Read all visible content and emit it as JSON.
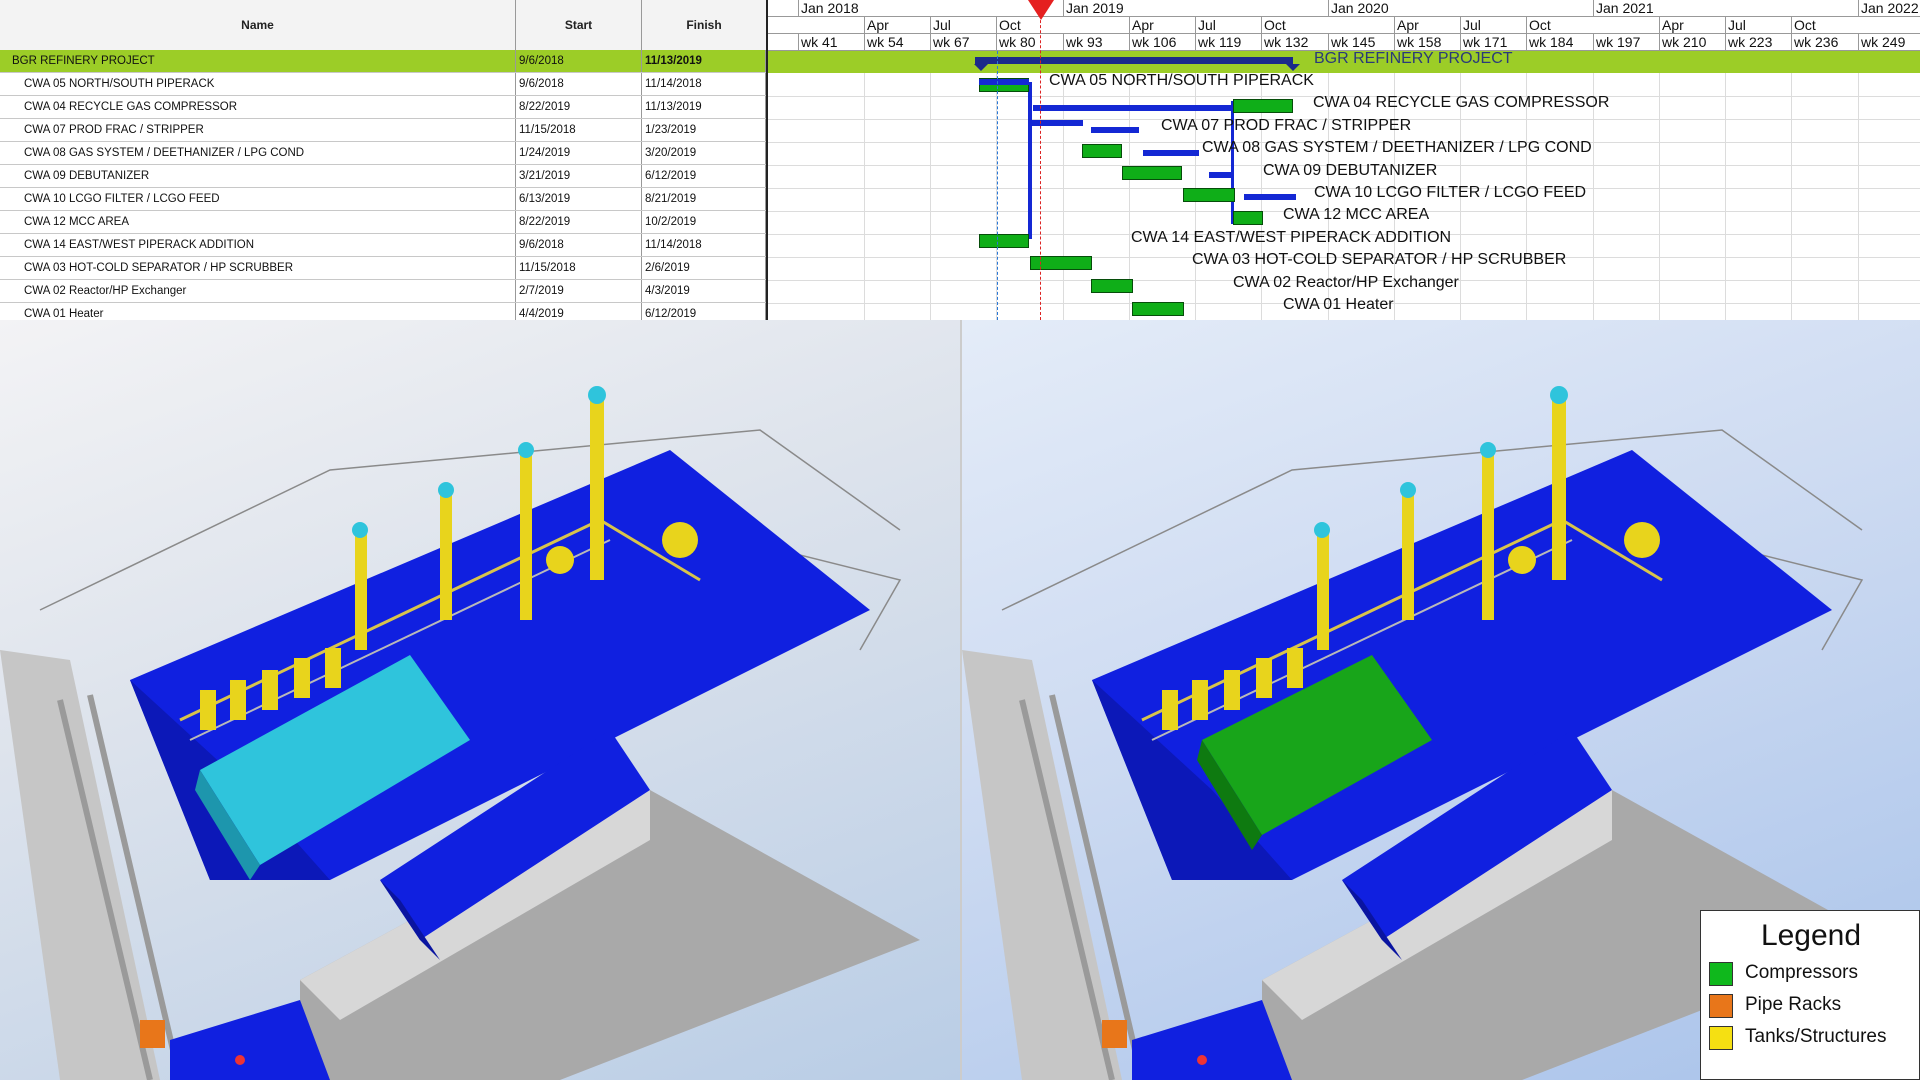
{
  "table": {
    "headers": {
      "name": "Name",
      "start": "Start",
      "finish": "Finish"
    },
    "rows": [
      {
        "name": "BGR REFINERY PROJECT",
        "start": "9/6/2018",
        "finish": "11/13/2019"
      },
      {
        "name": "CWA 05  NORTH/SOUTH PIPERACK",
        "start": "9/6/2018",
        "finish": "11/14/2018"
      },
      {
        "name": "CWA 04  RECYCLE GAS COMPRESSOR",
        "start": "8/22/2019",
        "finish": "11/13/2019"
      },
      {
        "name": "CWA 07  PROD FRAC / STRIPPER",
        "start": "11/15/2018",
        "finish": "1/23/2019"
      },
      {
        "name": "CWA 08  GAS SYSTEM / DEETHANIZER / LPG COND",
        "start": "1/24/2019",
        "finish": "3/20/2019"
      },
      {
        "name": "CWA 09  DEBUTANIZER",
        "start": "3/21/2019",
        "finish": "6/12/2019"
      },
      {
        "name": "CWA 10  LCGO FILTER / LCGO FEED",
        "start": "6/13/2019",
        "finish": "8/21/2019"
      },
      {
        "name": "CWA 12  MCC AREA",
        "start": "8/22/2019",
        "finish": "10/2/2019"
      },
      {
        "name": "CWA 14 EAST/WEST PIPERACK ADDITION",
        "start": "9/6/2018",
        "finish": "11/14/2018"
      },
      {
        "name": "CWA 03  HOT-COLD SEPARATOR / HP SCRUBBER",
        "start": "11/15/2018",
        "finish": "2/6/2019"
      },
      {
        "name": "CWA 02 Reactor/HP Exchanger",
        "start": "2/7/2019",
        "finish": "4/3/2019"
      },
      {
        "name": "CWA 01 Heater",
        "start": "4/4/2019",
        "finish": "6/12/2019"
      }
    ]
  },
  "timeline": {
    "years": [
      "Jan 2018",
      "Jan 2019",
      "Jan 2020",
      "Jan 2021",
      "Jan 2022"
    ],
    "months": [
      "Apr",
      "Jul",
      "Oct",
      "Apr",
      "Jul",
      "Oct",
      "Apr",
      "Jul",
      "Oct",
      "Apr",
      "Jul",
      "Oct"
    ],
    "weeks": [
      "wk 41",
      "wk 54",
      "wk 67",
      "wk 80",
      "wk 93",
      "wk 106",
      "wk 119",
      "wk 132",
      "wk 145",
      "wk 158",
      "wk 171",
      "wk 184",
      "wk 197",
      "wk 210",
      "wk 223",
      "wk 236",
      "wk 249"
    ]
  },
  "gantt_labels": [
    "BGR REFINERY PROJECT",
    "CWA 05  NORTH/SOUTH PIPERACK",
    "CWA 04  RECYCLE GAS COMPRESSOR",
    "CWA 07  PROD FRAC / STRIPPER",
    "CWA 08  GAS SYSTEM / DEETHANIZER / LPG COND",
    "CWA 09  DEBUTANIZER",
    "CWA 10  LCGO FILTER / LCGO FEED",
    "CWA 12  MCC AREA",
    "CWA 14 EAST/WEST PIPERACK ADDITION",
    "CWA 03  HOT-COLD SEPARATOR / HP SCRUBBER",
    "CWA 02 Reactor/HP Exchanger",
    "CWA 01 Heater"
  ],
  "legend": {
    "title": "Legend",
    "items": [
      {
        "label": "Compressors",
        "color": "#0fb81c"
      },
      {
        "label": "Pipe Racks",
        "color": "#e8761a"
      },
      {
        "label": "Tanks/Structures",
        "color": "#f5e012"
      }
    ]
  },
  "colors": {
    "summary_band": "#9ccd27",
    "task_bar": "#0fae18",
    "link": "#1428d4",
    "structure_blue": "#1020e0",
    "equipment_yellow": "#e8d41c",
    "compressor_cyan": "#2fc4dc",
    "compressor_green": "#18a51a"
  }
}
